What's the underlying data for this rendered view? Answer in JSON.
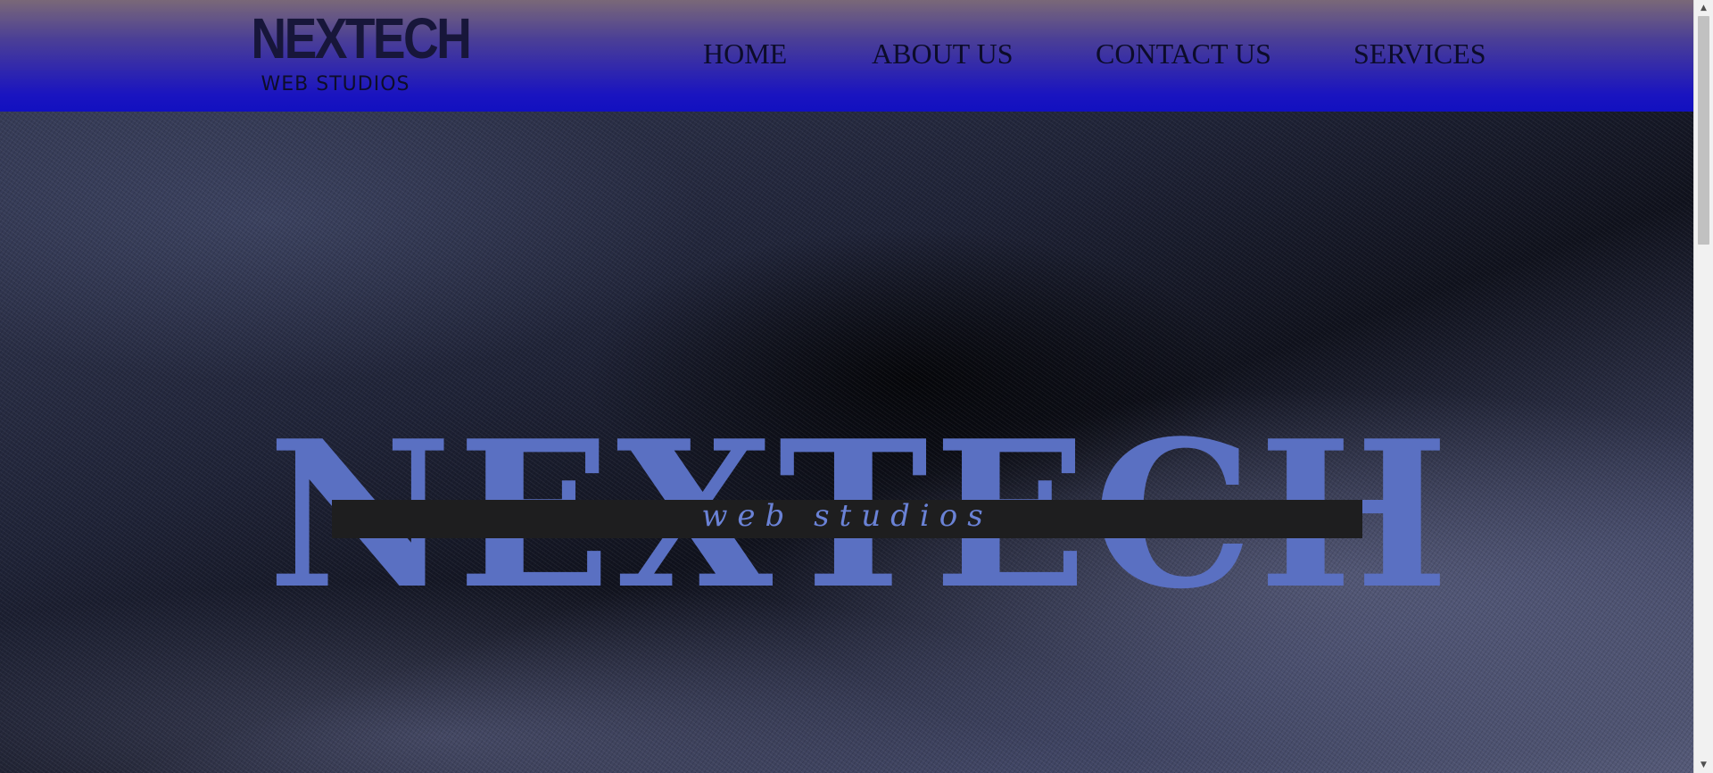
{
  "header": {
    "logo_title": "NEXTECH",
    "logo_subtitle": "WEB STUDIOS",
    "nav": [
      {
        "label": "HOME"
      },
      {
        "label": "ABOUT US"
      },
      {
        "label": "CONTACT US"
      },
      {
        "label": "SERVICES"
      }
    ]
  },
  "hero": {
    "wordmark": "NEXTECH",
    "tagline": "web studios"
  },
  "scrollbar": {
    "up_icon": "chevron-up-icon",
    "down_icon": "chevron-down-icon"
  },
  "colors": {
    "header_top": "#7a6878",
    "header_bottom": "#1210c0",
    "wordmark": "#5a70c2",
    "band": "#1e1e1f",
    "tagline": "#6a82d6"
  }
}
